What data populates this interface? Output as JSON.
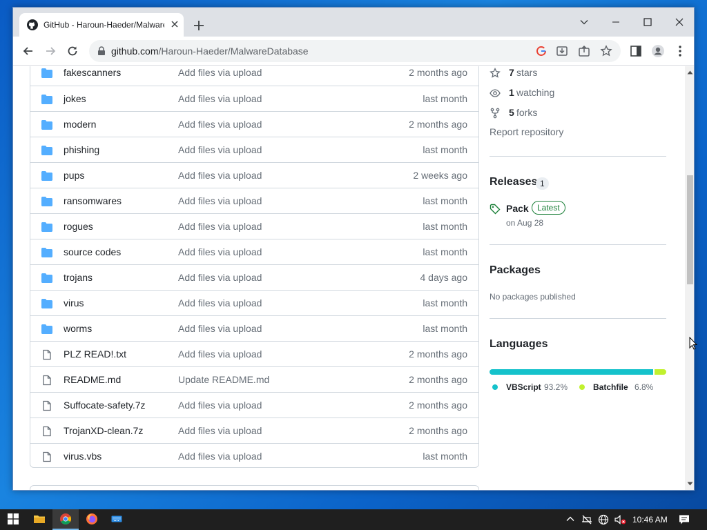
{
  "browser": {
    "tab_title": "GitHub - Haroun-Haeder/MalwareDatabase",
    "url_host": "github.com",
    "url_path": "/Haroun-Haeder/MalwareDatabase"
  },
  "files": [
    {
      "name": "fakescanners",
      "type": "folder",
      "message": "Add files via upload",
      "date": "2 months ago"
    },
    {
      "name": "jokes",
      "type": "folder",
      "message": "Add files via upload",
      "date": "last month"
    },
    {
      "name": "modern",
      "type": "folder",
      "message": "Add files via upload",
      "date": "2 months ago"
    },
    {
      "name": "phishing",
      "type": "folder",
      "message": "Add files via upload",
      "date": "last month"
    },
    {
      "name": "pups",
      "type": "folder",
      "message": "Add files via upload",
      "date": "2 weeks ago"
    },
    {
      "name": "ransomwares",
      "type": "folder",
      "message": "Add files via upload",
      "date": "last month"
    },
    {
      "name": "rogues",
      "type": "folder",
      "message": "Add files via upload",
      "date": "last month"
    },
    {
      "name": "source codes",
      "type": "folder",
      "message": "Add files via upload",
      "date": "last month"
    },
    {
      "name": "trojans",
      "type": "folder",
      "message": "Add files via upload",
      "date": "4 days ago"
    },
    {
      "name": "virus",
      "type": "folder",
      "message": "Add files via upload",
      "date": "last month"
    },
    {
      "name": "worms",
      "type": "folder",
      "message": "Add files via upload",
      "date": "last month"
    },
    {
      "name": "PLZ READ!.txt",
      "type": "file",
      "message": "Add files via upload",
      "date": "2 months ago"
    },
    {
      "name": "README.md",
      "type": "file",
      "message": "Update README.md",
      "date": "2 months ago"
    },
    {
      "name": "Suffocate-safety.7z",
      "type": "file",
      "message": "Add files via upload",
      "date": "2 months ago"
    },
    {
      "name": "TrojanXD-clean.7z",
      "type": "file",
      "message": "Add files via upload",
      "date": "2 months ago"
    },
    {
      "name": "virus.vbs",
      "type": "file",
      "message": "Add files via upload",
      "date": "last month"
    }
  ],
  "sidebar": {
    "stars_count": "7",
    "stars_label": "stars",
    "watching_count": "1",
    "watching_label": "watching",
    "forks_count": "5",
    "forks_label": "forks",
    "report": "Report repository",
    "releases_title": "Releases",
    "releases_count": "1",
    "release_name": "Pack",
    "release_badge": "Latest",
    "release_date": "on Aug 28",
    "packages_title": "Packages",
    "packages_empty": "No packages published",
    "languages_title": "Languages",
    "languages": [
      {
        "name": "VBScript",
        "percent": "93.2%",
        "value": 93.2,
        "color": "#15c2cb"
      },
      {
        "name": "Batchfile",
        "percent": "6.8%",
        "value": 6.8,
        "color": "#c1f12e"
      }
    ]
  },
  "taskbar": {
    "clock": "10:46 AM",
    "icons": [
      "windows-start-icon",
      "file-explorer-icon",
      "chrome-icon",
      "firefox-icon",
      "keyboard-app-icon"
    ]
  }
}
